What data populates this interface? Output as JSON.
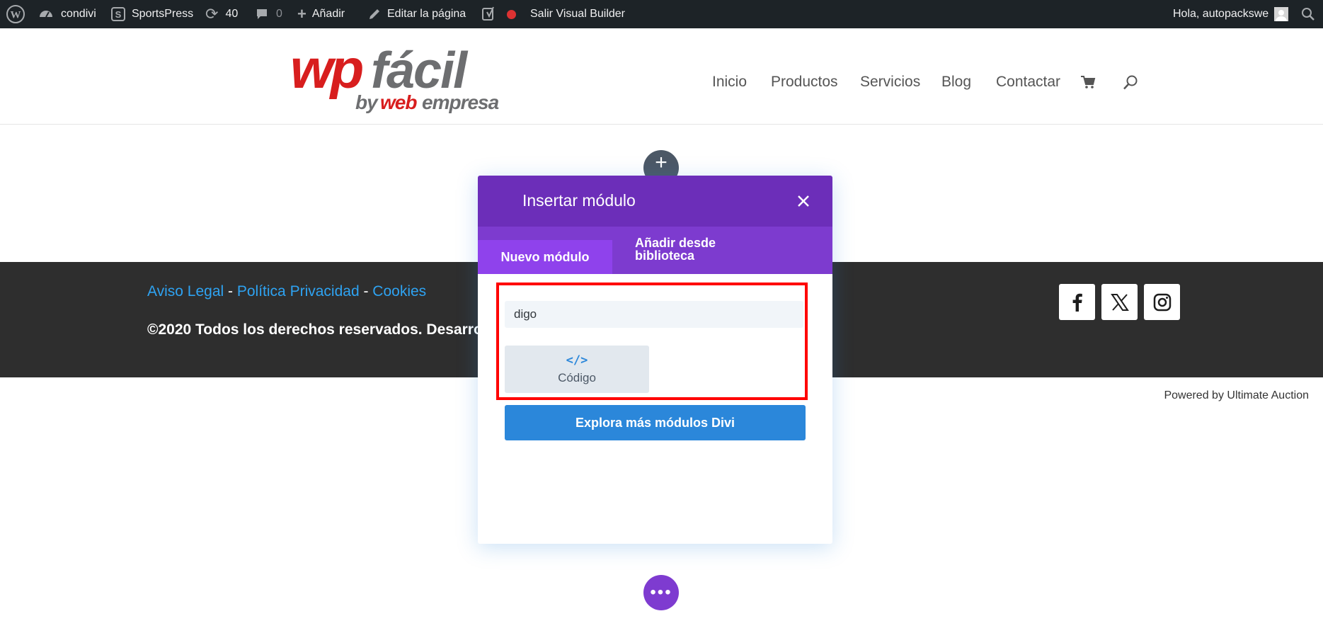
{
  "adminbar": {
    "site_name": "condivi",
    "sportspress": "SportsPress",
    "updates_count": "40",
    "comments_count": "0",
    "add_new": "Añadir",
    "edit_page": "Editar la página",
    "exit_builder": "Salir Visual Builder",
    "greeting": "Hola, autopackswe"
  },
  "header": {
    "logo_text_main": "wpfácil",
    "logo_text_sub_by": "by",
    "logo_text_sub_web": "web",
    "logo_text_sub_empresa": "empresa",
    "menu": [
      "Inicio",
      "Productos",
      "Servicios",
      "Blog",
      "Contactar"
    ]
  },
  "footer": {
    "link_legal": "Aviso Legal",
    "separator": " - ",
    "link_privacy": "Política Privacidad",
    "link_cookies": "Cookies",
    "copyright": "©2020 Todos los derechos reservados. Desarrolla",
    "social": [
      "facebook-icon",
      "x-icon",
      "instagram-icon"
    ]
  },
  "powered_by": "Powered by Ultimate Auction",
  "modal": {
    "title": "Insertar módulo",
    "tab_new": "Nuevo módulo",
    "tab_library": "Añadir desde biblioteca",
    "search_value": "digo",
    "module_label": "Código",
    "module_icon": "</>",
    "explore_button": "Explora más módulos Divi"
  },
  "colors": {
    "adminbar_bg": "#1d2327",
    "modal_header": "#6c2eb9",
    "tabs_bg": "#7d3bcf",
    "active_tab": "#8f42ec",
    "accent_blue": "#2b87da",
    "highlight_red": "#ff0000",
    "footer_bg": "#2e2e2e"
  }
}
